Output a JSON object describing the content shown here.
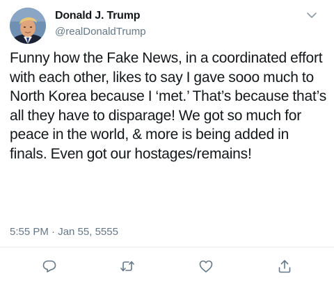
{
  "tweet": {
    "author": {
      "name": "Donald J. Trump",
      "handle": "@realDonaldTrump",
      "avatar_icon": "profile-photo"
    },
    "text": "Funny how the Fake News, in a coordinated effort with each other, likes to say I gave sooo much to North Korea because I ‘met.’ That’s because that’s all they have to disparage! We got so much for peace in the world, & more is being added in finals. Even got our hostages/remains!",
    "timestamp": "5:55 PM · Jan 55, 5555",
    "menu_icon": "chevron-down-icon",
    "actions": [
      {
        "name": "reply",
        "icon": "reply-icon"
      },
      {
        "name": "retweet",
        "icon": "retweet-icon"
      },
      {
        "name": "like",
        "icon": "heart-icon"
      },
      {
        "name": "share",
        "icon": "share-icon"
      }
    ]
  },
  "colors": {
    "text": "#14171a",
    "secondary": "#657786",
    "icon": "#657786",
    "divider": "#e6ecf0"
  }
}
